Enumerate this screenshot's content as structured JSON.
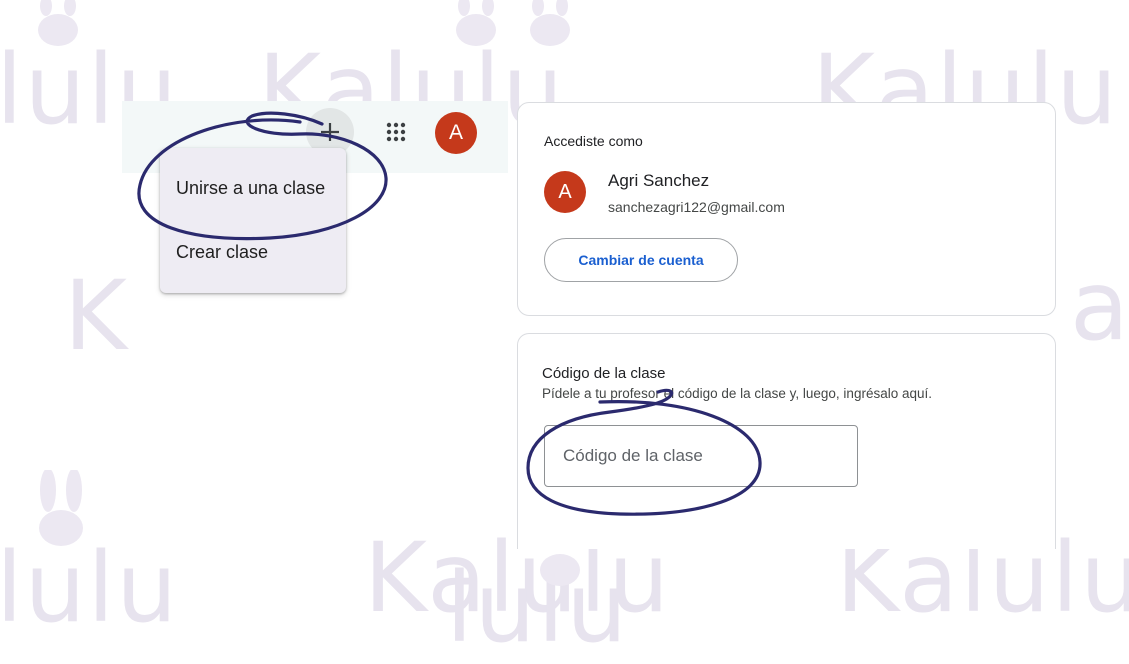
{
  "watermark": {
    "text_a": "Kalulu",
    "text_b": "lulu",
    "text_c": "K",
    "text_d": "a"
  },
  "topbar": {
    "plus_icon": "plus-icon",
    "apps_icon": "apps-grid-icon",
    "avatar_letter": "A",
    "avatar_color": "#c5391b"
  },
  "menu": {
    "items": [
      {
        "label": "Unirse a una clase"
      },
      {
        "label": "Crear clase"
      }
    ]
  },
  "account": {
    "label": "Accediste como",
    "avatar_letter": "A",
    "name": "Agri Sanchez",
    "email": "sanchezagri122@gmail.com",
    "switch_label": "Cambiar de cuenta"
  },
  "class_code": {
    "title": "Código de la clase",
    "description": "Pídele a tu profesor el código de la clase y, luego, ingrésalo aquí.",
    "placeholder": "Código de la clase",
    "value": ""
  },
  "colors": {
    "accent": "#1a5fd0",
    "annotation": "#2b2a6e",
    "watermark": "#e7e3ee"
  }
}
